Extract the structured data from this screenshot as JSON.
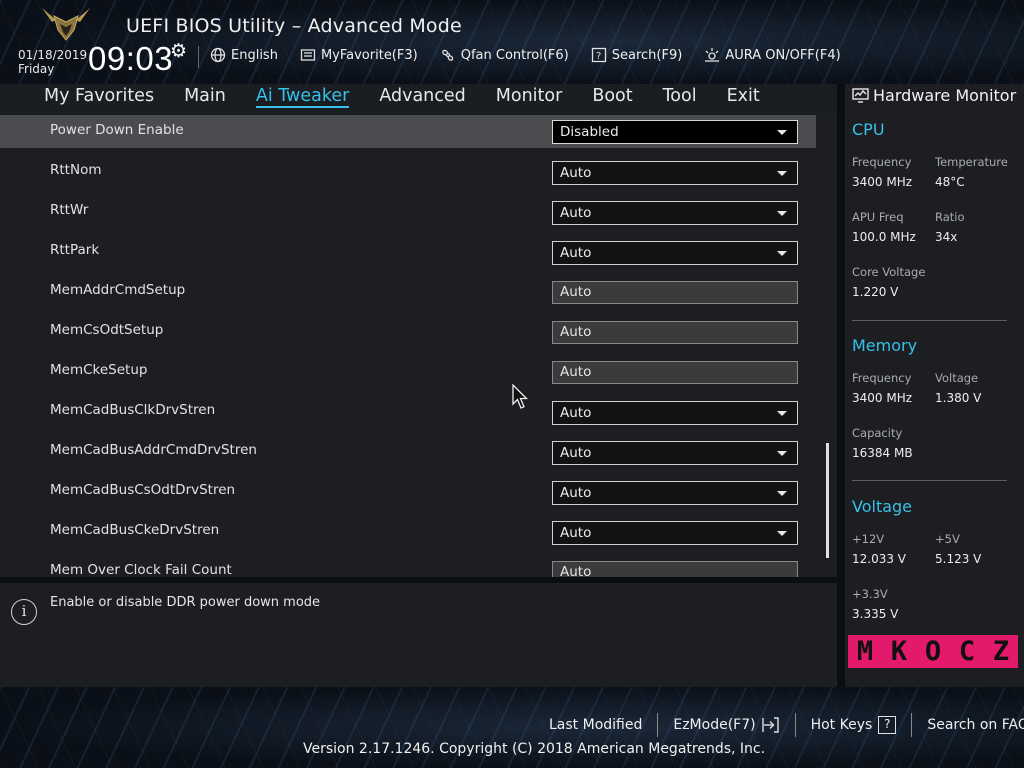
{
  "header": {
    "title": "UEFI BIOS Utility – Advanced Mode",
    "date": "01/18/2019",
    "day": "Friday",
    "time": "09:03",
    "toolbar": [
      {
        "label": "English",
        "icon": "globe-icon"
      },
      {
        "label": "MyFavorite(F3)",
        "icon": "favorite-icon"
      },
      {
        "label": "Qfan Control(F6)",
        "icon": "fan-icon"
      },
      {
        "label": "Search(F9)",
        "icon": "search-icon"
      },
      {
        "label": "AURA ON/OFF(F4)",
        "icon": "aura-icon"
      }
    ]
  },
  "tabs": [
    "My Favorites",
    "Main",
    "Ai Tweaker",
    "Advanced",
    "Monitor",
    "Boot",
    "Tool",
    "Exit"
  ],
  "active_tab": "Ai Tweaker",
  "settings": [
    {
      "label": "Power Down Enable",
      "value": "Disabled",
      "kind": "dropdown",
      "selected": true
    },
    {
      "label": "RttNom",
      "value": "Auto",
      "kind": "dropdown"
    },
    {
      "label": "RttWr",
      "value": "Auto",
      "kind": "dropdown"
    },
    {
      "label": "RttPark",
      "value": "Auto",
      "kind": "dropdown"
    },
    {
      "label": "MemAddrCmdSetup",
      "value": "Auto",
      "kind": "text"
    },
    {
      "label": "MemCsOdtSetup",
      "value": "Auto",
      "kind": "text"
    },
    {
      "label": "MemCkeSetup",
      "value": "Auto",
      "kind": "text"
    },
    {
      "label": "MemCadBusClkDrvStren",
      "value": "Auto",
      "kind": "dropdown"
    },
    {
      "label": "MemCadBusAddrCmdDrvStren",
      "value": "Auto",
      "kind": "dropdown"
    },
    {
      "label": "MemCadBusCsOdtDrvStren",
      "value": "Auto",
      "kind": "dropdown"
    },
    {
      "label": "MemCadBusCkeDrvStren",
      "value": "Auto",
      "kind": "dropdown"
    },
    {
      "label": "Mem Over Clock Fail Count",
      "value": "Auto",
      "kind": "text"
    }
  ],
  "help": {
    "text": "Enable or disable DDR power down mode"
  },
  "hardware_monitor": {
    "title": "Hardware Monitor",
    "cpu": {
      "heading": "CPU",
      "frequency_label": "Frequency",
      "frequency": "3400 MHz",
      "temperature_label": "Temperature",
      "temperature": "48°C",
      "apu_freq_label": "APU Freq",
      "apu_freq": "100.0 MHz",
      "ratio_label": "Ratio",
      "ratio": "34x",
      "core_voltage_label": "Core Voltage",
      "core_voltage": "1.220 V"
    },
    "memory": {
      "heading": "Memory",
      "frequency_label": "Frequency",
      "frequency": "3400 MHz",
      "voltage_label": "Voltage",
      "voltage": "1.380 V",
      "capacity_label": "Capacity",
      "capacity": "16384 MB"
    },
    "voltage": {
      "heading": "Voltage",
      "v12_label": "+12V",
      "v12": "12.033 V",
      "v5_label": "+5V",
      "v5": "5.123 V",
      "v33_label": "+3.3V",
      "v33": "3.335 V"
    },
    "watermark": "MKOCZ",
    "watermark_color": "#e3196b"
  },
  "footer": {
    "last_modified": "Last Modified",
    "ezmode": "EzMode(F7)",
    "hot_keys": "Hot Keys",
    "hot_keys_key": "?",
    "search_faq": "Search on FAQ",
    "version": "Version 2.17.1246. Copyright (C) 2018 American Megatrends, Inc."
  },
  "colors": {
    "accent": "#37c0e8"
  }
}
